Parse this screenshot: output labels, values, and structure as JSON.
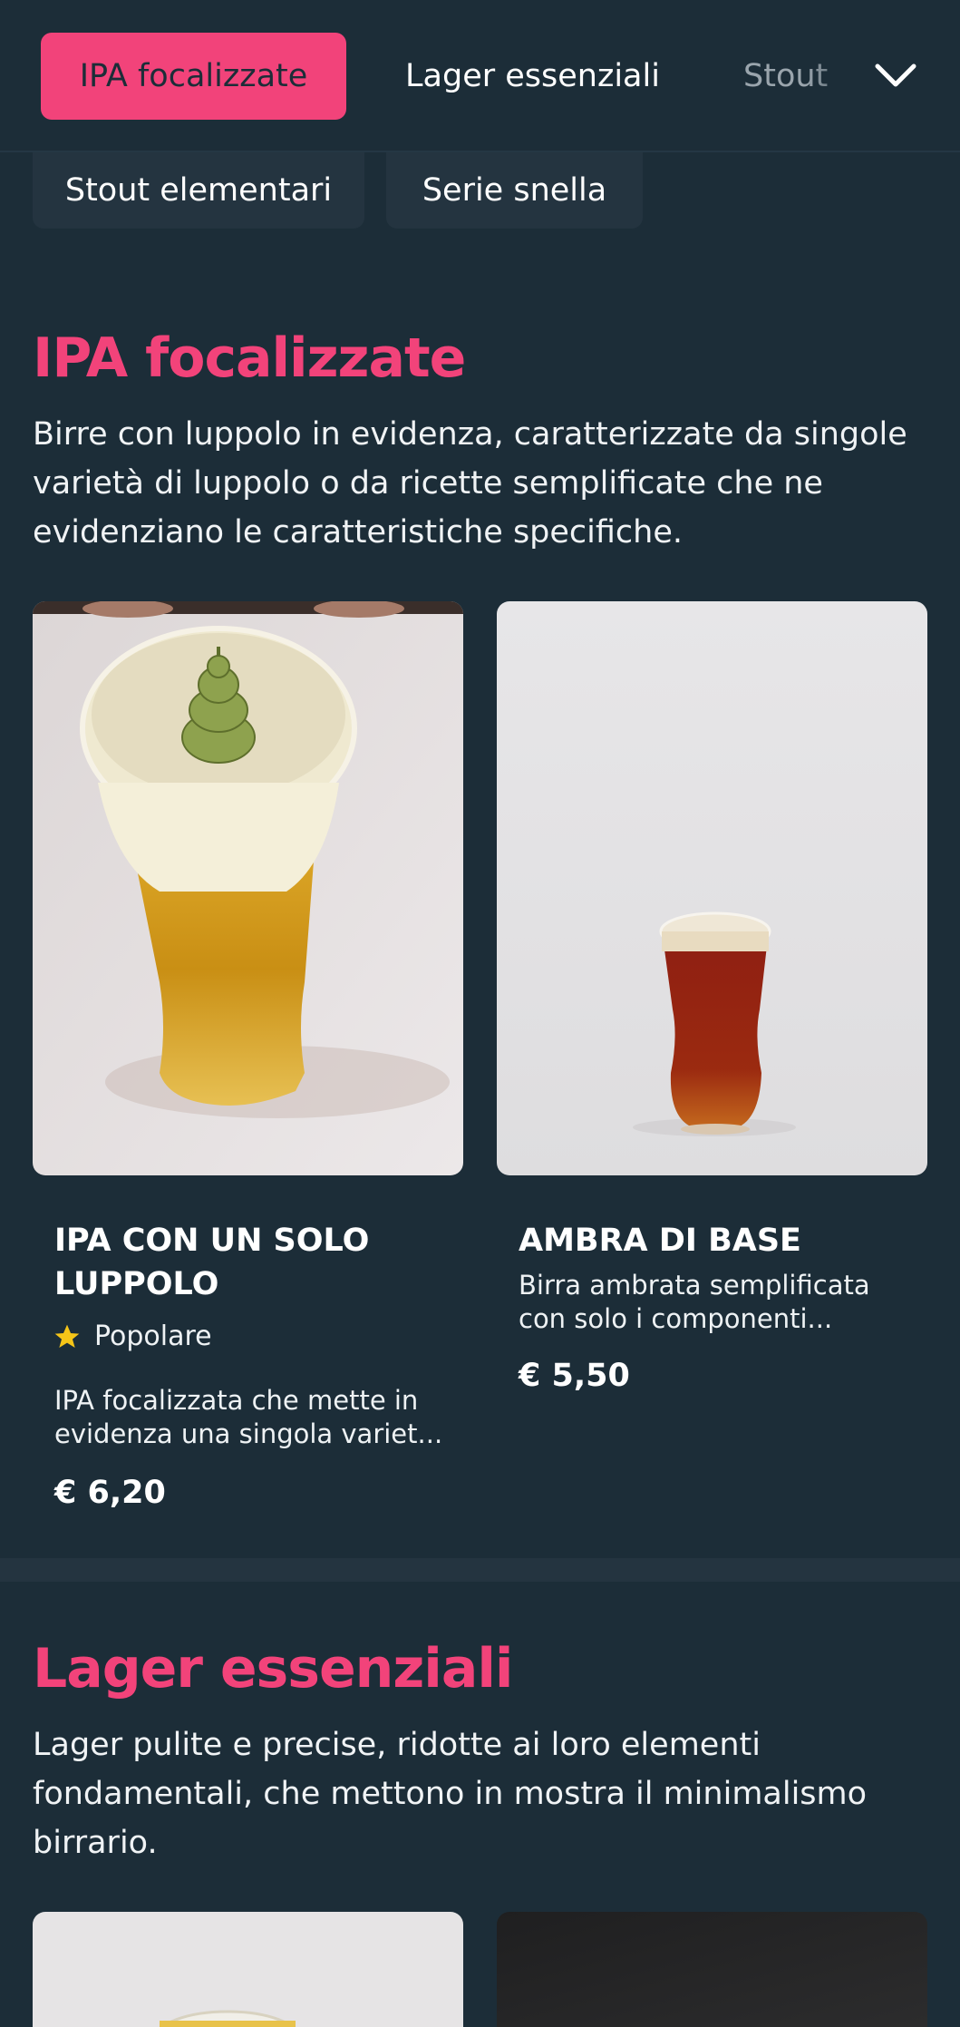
{
  "nav": {
    "tabs": [
      {
        "label": "IPA focalizzate"
      },
      {
        "label": "Lager essenziali"
      },
      {
        "label": "Stout"
      }
    ],
    "chips": [
      {
        "label": "Stout elementari"
      },
      {
        "label": "Serie snella"
      }
    ]
  },
  "sections": [
    {
      "title": "IPA focalizzate",
      "description": "Birre con luppolo in evidenza, caratterizzate da singole varietà di luppolo o da ricette semplificate che ne evidenziano le caratteristiche specifiche.",
      "products": [
        {
          "name": "IPA CON UN SOLO LUPPOLO",
          "badge": "Popolare",
          "description": "IPA focalizzata che mette in evidenza una singola variet...",
          "price": "€ 6,20"
        },
        {
          "name": "AMBRA DI BASE",
          "description": "Birra ambrata semplificata con solo i componenti...",
          "price": "€ 5,50"
        }
      ]
    },
    {
      "title": "Lager essenziali",
      "description": "Lager pulite e precise, ridotte ai loro elementi fondamentali, che mettono in mostra il minimalismo birrario."
    }
  ],
  "colors": {
    "background": "#1c2d38",
    "accent": "#f2437a",
    "chip": "#243440",
    "star": "#f5c518"
  },
  "icons": {
    "chevron": "chevron-down-icon",
    "star": "star-icon"
  }
}
